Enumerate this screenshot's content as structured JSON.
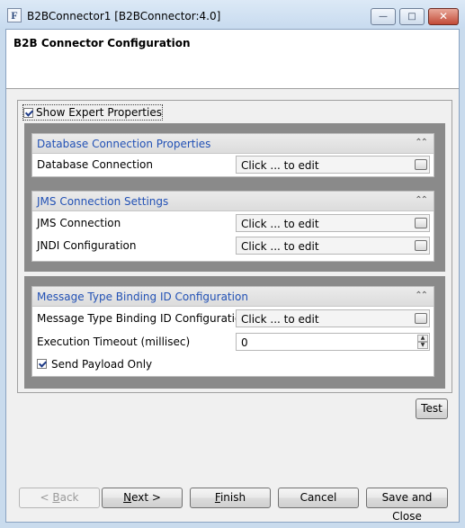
{
  "window": {
    "title": "B2BConnector1 [B2BConnector:4.0]",
    "icon_letter": "F",
    "minimize_glyph": "—",
    "maximize_glyph": "□",
    "close_glyph": "✕"
  },
  "header": {
    "title": "B2B Connector Configuration"
  },
  "show_expert": {
    "label": "Show Expert Properties",
    "checked": true
  },
  "sections": [
    {
      "title": "Database Connection Properties",
      "rows": [
        {
          "label": "Database Connection",
          "value": "Click ... to edit"
        }
      ]
    },
    {
      "title": "JMS Connection Settings",
      "rows": [
        {
          "label": "JMS Connection",
          "value": "Click ... to edit"
        },
        {
          "label": "JNDI Configuration",
          "value": "Click ... to edit"
        }
      ]
    },
    {
      "title": "Message Type Binding ID Configuration",
      "rows": [
        {
          "label": "Message Type Binding ID Configuration",
          "value": "Click ... to edit"
        },
        {
          "label": "Execution Timeout (millisec)",
          "value": "0"
        }
      ],
      "checkbox": {
        "label": "Send Payload Only",
        "checked": true
      }
    }
  ],
  "collapse_glyph": "⌃⌃",
  "buttons": {
    "test": "Test",
    "back": {
      "prefix": "< ",
      "mnemonic": "B",
      "rest": "ack"
    },
    "next": {
      "mnemonic": "N",
      "rest": "ext >"
    },
    "finish": {
      "mnemonic": "F",
      "rest": "inish"
    },
    "cancel": "Cancel",
    "save_close": "Save and Close"
  }
}
